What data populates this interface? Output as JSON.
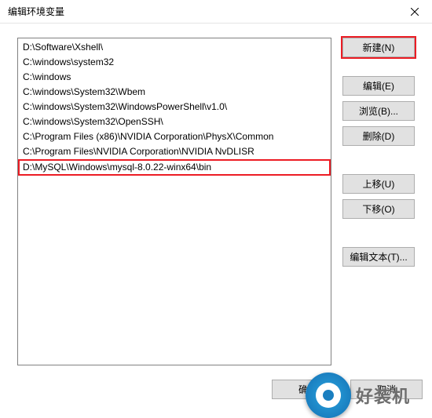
{
  "title": "编辑环境变量",
  "paths": [
    "D:\\Software\\Xshell\\",
    "C:\\windows\\system32",
    "C:\\windows",
    "C:\\windows\\System32\\Wbem",
    "C:\\windows\\System32\\WindowsPowerShell\\v1.0\\",
    "C:\\windows\\System32\\OpenSSH\\",
    "C:\\Program Files (x86)\\NVIDIA Corporation\\PhysX\\Common",
    "C:\\Program Files\\NVIDIA Corporation\\NVIDIA NvDLISR",
    "D:\\MySQL\\Windows\\mysql-8.0.22-winx64\\bin"
  ],
  "highlighted_path_index": 8,
  "buttons": {
    "new": "新建(N)",
    "edit": "编辑(E)",
    "browse": "浏览(B)...",
    "delete": "删除(D)",
    "moveup": "上移(U)",
    "movedown": "下移(O)",
    "edittext": "编辑文本(T)...",
    "ok": "确定",
    "cancel": "取消"
  },
  "watermark": "好装机"
}
